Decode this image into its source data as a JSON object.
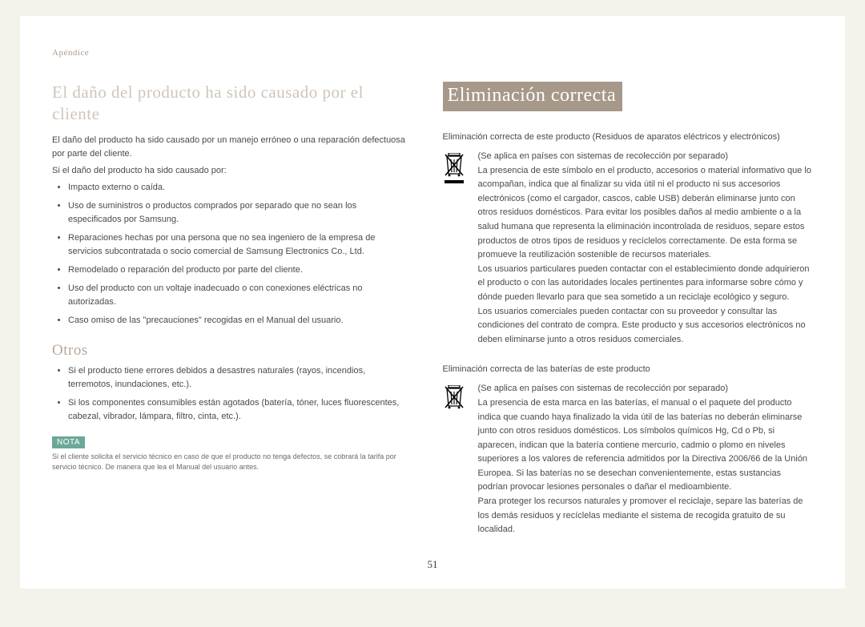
{
  "breadcrumb": "Apéndice",
  "left": {
    "heading1": "El daño del producto ha sido causado por el cliente",
    "p1": "El daño del producto ha sido causado por un manejo erróneo o una reparación defectuosa por parte del cliente.",
    "p2": "Si el daño del producto ha sido causado por:",
    "bullets1": [
      "Impacto externo o caída.",
      "Uso de suministros o productos comprados por separado que no sean los especificados por Samsung.",
      "Reparaciones hechas por una persona que no sea ingeniero de la empresa de servicios subcontratada o socio comercial de Samsung Electronics Co., Ltd.",
      "Remodelado o reparación del producto por parte del cliente.",
      "Uso del producto con un voltaje inadecuado o con conexiones eléctricas no autorizadas.",
      "Caso omiso de las \"precauciones\" recogidas en el Manual del usuario."
    ],
    "heading2": "Otros",
    "bullets2": [
      "Si el producto tiene errores debidos a desastres naturales (rayos, incendios, terremotos, inundaciones, etc.).",
      "Si los componentes consumibles están agotados (batería, tóner, luces fluorescentes, cabezal, vibrador, lámpara, filtro, cinta, etc.)."
    ],
    "nota_label": "NOTA",
    "nota_text": "Si el cliente solicita el servicio técnico en caso de que el producto no tenga defectos, se cobrará la tarifa por servicio técnico. De manera que lea el Manual del usuario antes."
  },
  "right": {
    "bar_title": "Eliminación correcta",
    "sub1": "Eliminación correcta de este producto (Residuos de aparatos eléctricos y electrónicos)",
    "block1_a": "(Se aplica en países con sistemas de recolección por separado)",
    "block1_b": "La presencia de este símbolo en el producto, accesorios o material informativo que lo acompañan, indica que al finalizar su vida útil ni el producto ni sus accesorios electrónicos (como el cargador, cascos, cable USB) deberán eliminarse junto con otros residuos domésticos. Para evitar los posibles daños al medio ambiente o a la salud humana que representa la eliminación incontrolada de residuos, separe estos productos de otros tipos de residuos y recíclelos correctamente. De esta forma se promueve la reutilización sostenible de recursos materiales.",
    "block1_c": "Los usuarios particulares pueden contactar con el establecimiento donde adquirieron el producto o con las autoridades locales pertinentes para informarse sobre cómo y dónde pueden llevarlo para que sea sometido a un reciclaje ecológico y seguro.",
    "block1_d": "Los usuarios comerciales pueden contactar con su proveedor y consultar las condiciones del contrato de compra. Este producto y sus accesorios electrónicos no deben eliminarse junto a otros residuos comerciales.",
    "sub2": "Eliminación correcta de las baterías de este producto",
    "block2_a": "(Se aplica en países con sistemas de recolección por separado)",
    "block2_b": "La presencia de esta marca en las baterías, el manual o el paquete del producto indica que cuando haya finalizado la vida útil de las baterías no deberán eliminarse junto con otros residuos domésticos. Los símbolos químicos Hg, Cd o Pb, si aparecen, indican que la batería contiene mercurio, cadmio o plomo en niveles superiores a los valores de referencia admitidos por la Directiva 2006/66 de la Unión Europea. Si las baterías no se desechan convenientemente, estas sustancias podrían provocar lesiones personales o dañar el medioambiente.",
    "block2_c": "Para proteger los recursos naturales y promover el reciclaje, separe las baterías de los demás residuos y recíclelas mediante el sistema de recogida gratuito de su localidad."
  },
  "page_number": "51"
}
